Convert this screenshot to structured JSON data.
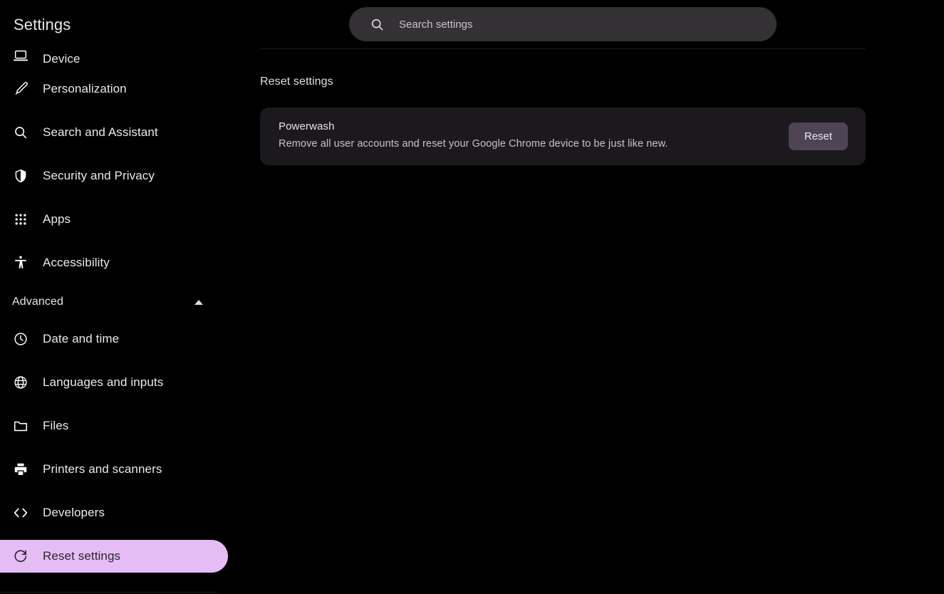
{
  "app": {
    "title": "Settings"
  },
  "search": {
    "placeholder": "Search settings",
    "value": "",
    "icon": "search-icon"
  },
  "sidebar": {
    "items": [
      {
        "label": "Device",
        "icon": "laptop-icon",
        "clipped": true,
        "selected": false
      },
      {
        "label": "Personalization",
        "icon": "brush-icon",
        "clipped": false,
        "selected": false
      },
      {
        "label": "Search and Assistant",
        "icon": "search-icon",
        "clipped": false,
        "selected": false
      },
      {
        "label": "Security and Privacy",
        "icon": "shield-icon",
        "clipped": false,
        "selected": false
      },
      {
        "label": "Apps",
        "icon": "grid-apps-icon",
        "clipped": false,
        "selected": false
      },
      {
        "label": "Accessibility",
        "icon": "accessibility-icon",
        "clipped": false,
        "selected": false
      }
    ],
    "advanced": {
      "label": "Advanced",
      "expanded": true,
      "caret_icon": "chevron-up-icon"
    },
    "advanced_items": [
      {
        "label": "Date and time",
        "icon": "clock-icon",
        "selected": false
      },
      {
        "label": "Languages and inputs",
        "icon": "globe-icon",
        "selected": false
      },
      {
        "label": "Files",
        "icon": "folder-icon",
        "selected": false
      },
      {
        "label": "Printers and scanners",
        "icon": "printer-icon",
        "selected": false
      },
      {
        "label": "Developers",
        "icon": "code-icon",
        "selected": false
      },
      {
        "label": "Reset settings",
        "icon": "restore-icon",
        "selected": true
      }
    ]
  },
  "main": {
    "section_title": "Reset settings",
    "powerwash": {
      "title": "Powerwash",
      "description": "Remove all user accounts and reset your Google Chrome device to be just like new.",
      "button_label": "Reset"
    }
  },
  "colors": {
    "background": "#000000",
    "selected_pill": "#e5bdf5",
    "selected_text": "#2b252e",
    "card_bg": "#1c191e",
    "search_bg": "#333133",
    "reset_button_bg": "#4f4456",
    "text_primary": "#e8e6e8",
    "text_secondary": "#c7c3c9"
  }
}
